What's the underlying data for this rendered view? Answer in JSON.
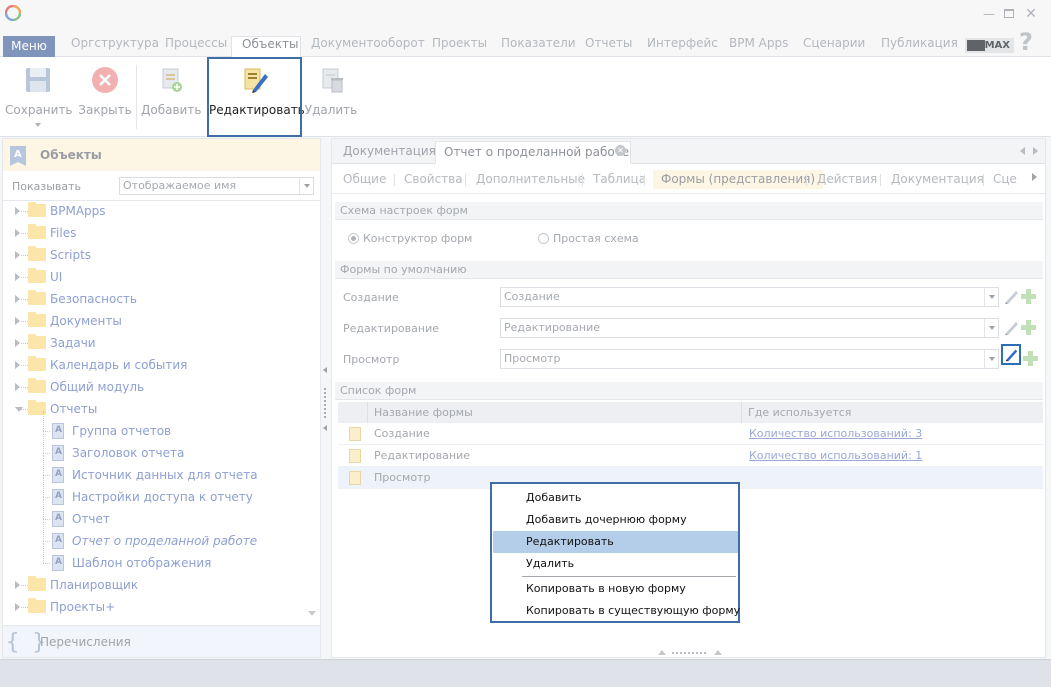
{
  "ribbon": {
    "menu_label": "Меню",
    "tabs": [
      {
        "label": "Оргструктура"
      },
      {
        "label": "Процессы"
      },
      {
        "label": "Объекты"
      },
      {
        "label": "Документооборот"
      },
      {
        "label": "Проекты"
      },
      {
        "label": "Показатели"
      },
      {
        "label": "Отчеты"
      },
      {
        "label": "Интерфейс"
      },
      {
        "label": "BPM Apps"
      },
      {
        "label": "Сценарии"
      },
      {
        "label": "Публикация"
      }
    ],
    "active_tab": "Объекты",
    "max_badge": "MAX",
    "help_glyph": "?"
  },
  "toolbar": {
    "save_label": "Сохранить",
    "close_label": "Закрыть",
    "add_label": "Добавить",
    "edit_label": "Редактировать",
    "delete_label": "Удалить"
  },
  "left_panel": {
    "title": "Объекты",
    "show_label": "Показывать",
    "show_value": "Отображаемое имя",
    "tree": [
      {
        "label": "BPMApps",
        "kind": "folder"
      },
      {
        "label": "Files",
        "kind": "folder"
      },
      {
        "label": "Scripts",
        "kind": "folder"
      },
      {
        "label": "UI",
        "kind": "folder"
      },
      {
        "label": "Безопасность",
        "kind": "folder"
      },
      {
        "label": "Документы",
        "kind": "folder"
      },
      {
        "label": "Задачи",
        "kind": "folder"
      },
      {
        "label": "Календарь и события",
        "kind": "folder"
      },
      {
        "label": "Общий модуль",
        "kind": "folder"
      },
      {
        "label": "Отчеты",
        "kind": "folder-open"
      },
      {
        "label": "Группа отчетов",
        "kind": "object"
      },
      {
        "label": "Заголовок отчета",
        "kind": "object"
      },
      {
        "label": "Источник данных для отчета",
        "kind": "object"
      },
      {
        "label": "Настройки доступа к отчету",
        "kind": "object"
      },
      {
        "label": "Отчет",
        "kind": "object"
      },
      {
        "label": "Отчет о проделанной работе",
        "kind": "object-italic"
      },
      {
        "label": "Шаблон отображения",
        "kind": "object"
      },
      {
        "label": "Планировщик",
        "kind": "folder"
      },
      {
        "label": "Проекты+",
        "kind": "folder"
      }
    ],
    "enum_label": "Перечисления"
  },
  "right_panel": {
    "doc_tabs": [
      {
        "label": "Документация"
      },
      {
        "label": "Отчет о проделанной работе"
      }
    ],
    "prop_tabs": [
      {
        "label": "Общие"
      },
      {
        "label": "Свойства"
      },
      {
        "label": "Дополнительные"
      },
      {
        "label": "Таблица"
      },
      {
        "label": "Формы (представления)"
      },
      {
        "label": "Действия"
      },
      {
        "label": "Документация"
      },
      {
        "label": "Сце"
      }
    ],
    "active_prop_tab": "Формы (представления)",
    "schema_section": "Схема настроек форм",
    "radio_constructor": "Конструктор форм",
    "radio_simple": "Простая схема",
    "defaults_section": "Формы по умолчанию",
    "default_forms": [
      {
        "label": "Создание",
        "value": "Создание"
      },
      {
        "label": "Редактирование",
        "value": "Редактирование"
      },
      {
        "label": "Просмотр",
        "value": "Просмотр"
      }
    ],
    "list_section": "Список форм",
    "table": {
      "headers": [
        "Название формы",
        "Где используется"
      ],
      "rows": [
        {
          "name": "Создание",
          "usage": "Количество использований: 3"
        },
        {
          "name": "Редактирование",
          "usage": "Количество использований: 1"
        },
        {
          "name": "Просмотр",
          "usage": ""
        }
      ]
    }
  },
  "context_menu": {
    "items": [
      {
        "label": "Добавить"
      },
      {
        "label": "Добавить дочернюю форму"
      },
      {
        "label": "Редактировать"
      },
      {
        "label": "Удалить"
      },
      {
        "label": "Копировать в новую форму"
      },
      {
        "label": "Копировать в существующую форму"
      }
    ],
    "highlighted": "Редактировать"
  },
  "colors": {
    "accent_frame": "#3f6ea7",
    "menu_highlight": "#b4cde9",
    "tree_text": "#8e9fd3",
    "folder": "#fbe5a8"
  }
}
